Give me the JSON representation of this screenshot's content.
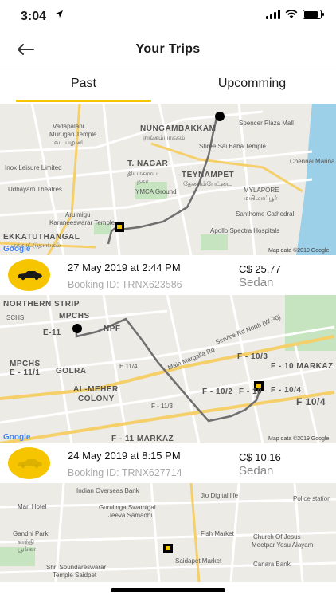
{
  "status": {
    "time": "3:04",
    "location_icon": "location-arrow-icon",
    "battery_level": 0.85
  },
  "header": {
    "title": "Your Trips",
    "back_icon": "arrow-left-icon"
  },
  "tabs": [
    {
      "label": "Past",
      "selected": true
    },
    {
      "label": "Upcomming",
      "selected": false
    }
  ],
  "colors": {
    "accent": "#f6c500",
    "route": "#6f6f6f",
    "muted_text": "#aaaaaa"
  },
  "trips": [
    {
      "date": "27 May 2019 at 2:44 PM",
      "booking": "Booking ID: TRNX623586",
      "fare": "C$ 25.77",
      "car_type": "Sedan",
      "map": {
        "labels": [
          "NUNGAMBAKKAM",
          "நுங்கம்பாக்கம்",
          "Spencer Plaza Mall",
          "Vadapalani",
          "Murugan Temple",
          "வடபழனி",
          "Shree Sai Baba Temple",
          "Inox Leisure Limited",
          "T. NAGAR",
          "தியாகராய",
          "நகர்",
          "TEYNAMPET",
          "தேனாம்பேட்டை",
          "Chennai Marina Lighthouse",
          "Udhayam Theatres",
          "YMCA Ground",
          "MYLAPORE",
          "மயிலாப்பூர்",
          "Santhome Cathedral",
          "Arulmigu",
          "Karaneeswarar Temple",
          "EKKATUTHANGAL",
          "எக்காட்டுதாங்கல்",
          "Apollo Spectra Hospitals"
        ],
        "credit": "Map data ©2019 Google"
      }
    },
    {
      "date": "24 May 2019 at 8:15 PM",
      "booking": "Booking ID: TRNX627714",
      "fare": "C$ 10.16",
      "car_type": "Sedan",
      "map": {
        "labels": [
          "NORTHERN STRIP",
          "MPCHS",
          "SCHS",
          "E-11",
          "NPF",
          "E 11/4",
          "MPCHS",
          "E - 11/1",
          "GOLRA",
          "AL-MEHER",
          "COLONY",
          "F - 11/3",
          "F - 11 MARKAZ",
          "Main Margalla Rd",
          "Service Rd North (W-30)",
          "F - 10/3",
          "F - 10 MARKAZ",
          "F - 10/2",
          "F - 10",
          "F - 10/4",
          "F 10/4"
        ],
        "credit": "Map data ©2019 Google"
      }
    },
    {
      "map": {
        "labels": [
          "Indian Overseas Bank",
          "Mari Hotel",
          "Gurulinga Swamigal",
          "Jeeva Samadhi",
          "Jio Digital life",
          "Police station",
          "Gandhi Park",
          "காந்தி",
          "பூங்கா",
          "Fish Market",
          "Church Of Jesus -",
          "Meetpar Yesu Alayam",
          "Canara Bank",
          "Shri Soundareswarar",
          "Temple Saidpet",
          "Saidapet Market"
        ]
      }
    }
  ],
  "google_logo": "Google"
}
